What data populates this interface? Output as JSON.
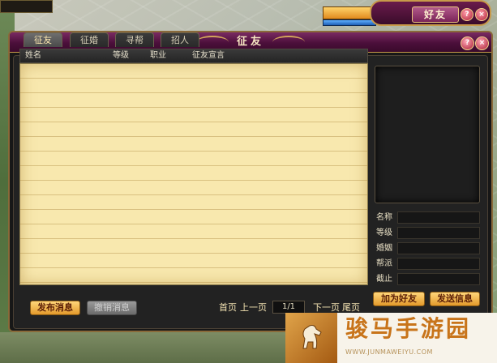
{
  "hud": {
    "top_left_text": "",
    "coords": ""
  },
  "friend_chip": {
    "label": "好友",
    "help": "?",
    "close": "×"
  },
  "window": {
    "title": "征友",
    "help": "?",
    "close": "×"
  },
  "tabs": [
    {
      "label": "征友",
      "active": true
    },
    {
      "label": "征婚",
      "active": false
    },
    {
      "label": "寻帮",
      "active": false
    },
    {
      "label": "招人",
      "active": false
    }
  ],
  "table": {
    "columns": [
      "姓名",
      "等级",
      "职业",
      "征友宣言"
    ],
    "rows": []
  },
  "profile": {
    "labels": [
      "名称",
      "等级",
      "婚姻",
      "帮派",
      "截止"
    ],
    "values": [
      "",
      "",
      "",
      "",
      ""
    ]
  },
  "buttons": {
    "post": "发布消息",
    "revoke": "撤销消息",
    "add_friend": "加为好友",
    "send_message": "发送信息"
  },
  "pager": {
    "first": "首页",
    "prev": "上一页",
    "page": "1/1",
    "next": "下一页",
    "last": "尾页"
  },
  "status_chip": "",
  "watermark": {
    "title": "骏马手游园",
    "url": "WWW.JUNMAWEIYU.COM"
  },
  "colors": {
    "title_bar": "#4b0f3a",
    "list_bg": "#f8e8ae",
    "button_gold": "#e39a2c",
    "border_gold": "#c79a4a"
  }
}
